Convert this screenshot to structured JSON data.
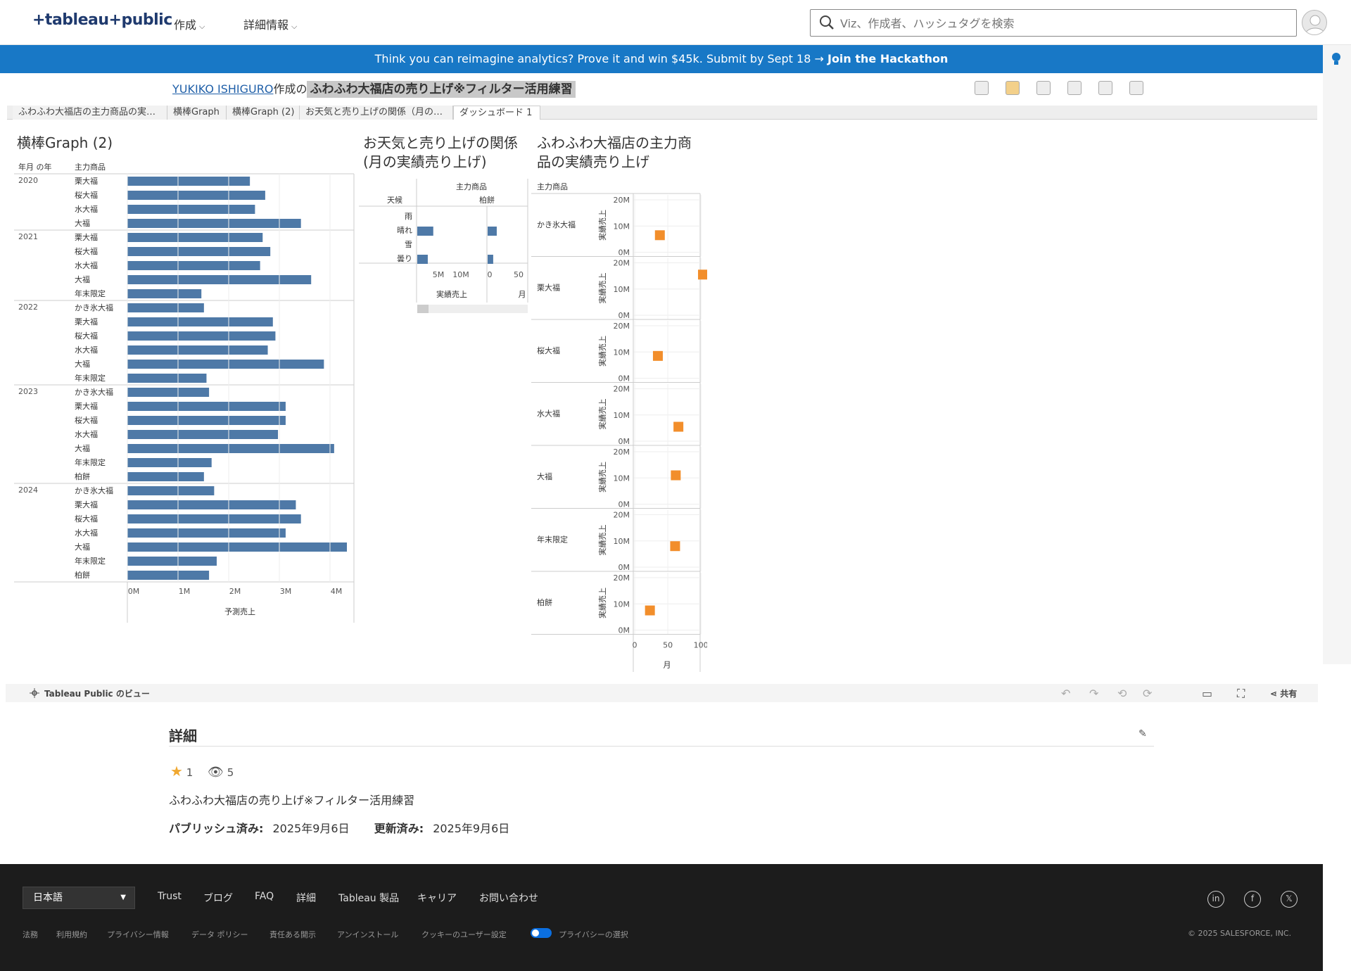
{
  "header": {
    "logo": "+tableau+public",
    "nav": [
      "作成",
      "詳細情報"
    ],
    "search_placeholder": "Viz、作成者、ハッシュタグを検索"
  },
  "banner": {
    "text": "Think you can reimagine analytics? Prove it and win $45k. Submit by Sept 18 →",
    "link": "Join the Hackathon"
  },
  "viz": {
    "author": "YUKIKO ISHIGURO",
    "by": "作成の",
    "title": "ふわふわ大福店の売り上げ※フィルター活用練習",
    "tabs": [
      "ふわふわ大福店の主力商品の実…",
      "横棒Graph",
      "横棒Graph (2)",
      "お天気と売り上げの関係（月の…",
      "ダッシュボード 1"
    ]
  },
  "chart_titles": {
    "c1": "横棒Graph (2)",
    "c2_line1": "お天気と売り上げの関係",
    "c2_line2": "(月の実績売り上げ)",
    "c3_line1": "ふわふわ大福店の主力商",
    "c3_line2": "品の実績売り上げ"
  },
  "chart_data": [
    {
      "type": "bar",
      "title": "横棒Graph (2)",
      "row_headers": [
        "年月 の年",
        "主力商品"
      ],
      "xlabel": "予測売上",
      "xlim": [
        0,
        4300000
      ],
      "x_ticks": [
        "0M",
        "1M",
        "2M",
        "3M",
        "4M"
      ],
      "groups": [
        {
          "year": "2020",
          "items": [
            [
              "栗大福",
              2.4
            ],
            [
              "桜大福",
              2.7
            ],
            [
              "水大福",
              2.5
            ],
            [
              "大福",
              3.4
            ]
          ]
        },
        {
          "year": "2021",
          "items": [
            [
              "栗大福",
              2.65
            ],
            [
              "桜大福",
              2.8
            ],
            [
              "水大福",
              2.6
            ],
            [
              "大福",
              3.6
            ],
            [
              "年末限定",
              1.45
            ]
          ]
        },
        {
          "year": "2022",
          "items": [
            [
              "かき氷大福",
              1.5
            ],
            [
              "栗大福",
              2.85
            ],
            [
              "桜大福",
              2.9
            ],
            [
              "水大福",
              2.75
            ],
            [
              "大福",
              3.85
            ],
            [
              "年末限定",
              1.55
            ]
          ]
        },
        {
          "year": "2023",
          "items": [
            [
              "かき氷大福",
              1.6
            ],
            [
              "栗大福",
              3.1
            ],
            [
              "桜大福",
              3.1
            ],
            [
              "水大福",
              2.95
            ],
            [
              "大福",
              4.05
            ],
            [
              "年末限定",
              1.65
            ],
            [
              "柏餅",
              1.5
            ]
          ]
        },
        {
          "year": "2024",
          "items": [
            [
              "かき氷大福",
              1.7
            ],
            [
              "栗大福",
              3.3
            ],
            [
              "桜大福",
              3.4
            ],
            [
              "水大福",
              3.1
            ],
            [
              "大福",
              4.3
            ],
            [
              "年末限定",
              1.75
            ],
            [
              "柏餅",
              1.6
            ]
          ]
        }
      ],
      "value_unit": "M"
    },
    {
      "type": "bar",
      "title": "お天気と売り上げの関係 (月の実績売り上げ)",
      "header_top": "主力商品",
      "header_col": "柏餅",
      "row_header": "天候",
      "categories": [
        "雨",
        "晴れ",
        "雪",
        "曇り"
      ],
      "series": [
        {
          "name": "実績売上",
          "values": [
            0,
            3.5,
            0,
            2.3
          ],
          "unit": "M",
          "ticks": [
            "5M",
            "10M"
          ]
        },
        {
          "name": "月",
          "values": [
            0,
            18,
            0,
            11
          ],
          "ticks": [
            "0",
            "50"
          ]
        }
      ]
    },
    {
      "type": "scatter",
      "title": "ふわふわ大福店の主力商品の実績売り上げ",
      "row_header": "主力商品",
      "ylabel": "実績売上",
      "xlabel": "月",
      "y_ticks": [
        "20M",
        "10M",
        "0M"
      ],
      "x_ticks": [
        "0",
        "50",
        "100"
      ],
      "ylim": [
        0,
        20
      ],
      "xlim": [
        0,
        120
      ],
      "rows": [
        {
          "name": "かき氷大福",
          "x": 38,
          "y": 6.5
        },
        {
          "name": "栗大福",
          "x": 103,
          "y": 15.5
        },
        {
          "name": "桜大福",
          "x": 35,
          "y": 8.5
        },
        {
          "name": "水大福",
          "x": 66,
          "y": 5.5
        },
        {
          "name": "大福",
          "x": 62,
          "y": 11
        },
        {
          "name": "年末限定",
          "x": 61,
          "y": 8
        },
        {
          "name": "柏餅",
          "x": 23,
          "y": 7.5
        }
      ]
    }
  ],
  "vizbar": {
    "label": "Tableau Public のビュー",
    "share": "共有"
  },
  "details": {
    "heading": "詳細",
    "favorites": "1",
    "views": "5",
    "description": "ふわふわ大福店の売り上げ※フィルター活用練習",
    "published_label": "パブリッシュ済み:",
    "published_date": "2025年9月6日",
    "updated_label": "更新済み:",
    "updated_date": "2025年9月6日"
  },
  "footer": {
    "language": "日本語",
    "links": [
      "Trust",
      "ブログ",
      "FAQ",
      "詳細",
      "Tableau 製品",
      "キャリア",
      "お問い合わせ"
    ],
    "sublinks": [
      "法務",
      "利用規約",
      "プライバシー情報",
      "データ ポリシー",
      "責任ある開示",
      "アンインストール",
      "クッキーのユーザー設定",
      "プライバシーの選択"
    ],
    "copyright": "© 2025 SALESFORCE, INC.",
    "social": [
      "in",
      "f",
      "𝕏"
    ]
  },
  "colors": {
    "bar": "#4e79a7",
    "point": "#f28e2b",
    "banner": "#1878c6"
  }
}
